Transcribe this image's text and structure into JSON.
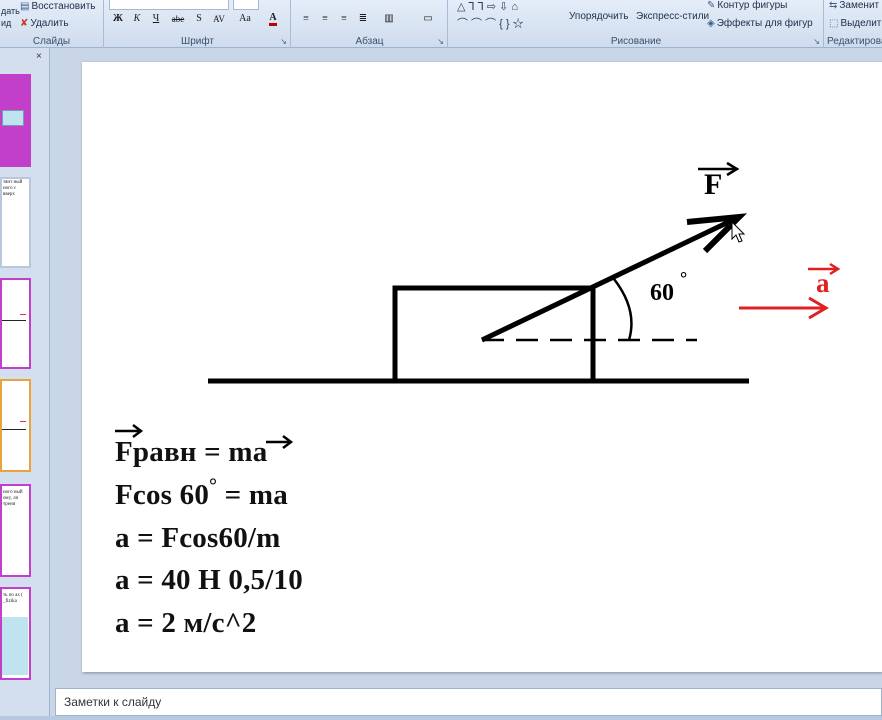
{
  "ribbon": {
    "slides_group": {
      "label": "Слайды",
      "restore": "Восстановить",
      "delete": "Удалить",
      "create_cut_1": "дать",
      "create_cut_2": "ид"
    },
    "font_group": {
      "label": "Шрифт",
      "buttons": [
        "Ж",
        "К",
        "Ч",
        "abe",
        "S",
        "AV",
        "Aa"
      ]
    },
    "paragraph_group": {
      "label": "Абзац"
    },
    "drawing_group": {
      "label": "Рисование",
      "arrange": "Упорядочить",
      "quick_styles": "Экспресс-стили",
      "shape_outline": "Контур фигуры",
      "shape_effects": "Эффекты для фигур"
    },
    "editing_group": {
      "label": "Редактирова",
      "replace": "Заменит",
      "select": "Выделит"
    }
  },
  "left_panel": {
    "close": "×",
    "thumbnails": [
      {
        "text": ""
      },
      {
        "text": "тянт ный ного с вверх"
      },
      {
        "text": ""
      },
      {
        "text": ""
      },
      {
        "text": "ного ный ому, ля трени"
      },
      {
        "text": "ть по ах ( _fizika"
      }
    ]
  },
  "slide": {
    "force_label": "F",
    "angle_label": "60",
    "angle_degree": "°",
    "acceleration_label": "a",
    "formulas": {
      "line1_F": "F",
      "line1_rest": "равн = ",
      "line1_ma": "ma",
      "line2_pre": "Fcos 60",
      "line2_deg": "°",
      "line2_post": " = ma",
      "line3": "a = Fcos60/m",
      "line4": "a = 40 Н 0,5/10",
      "line5": "a = 2 м/с^2"
    }
  },
  "notes": {
    "placeholder": "Заметки к слайду"
  }
}
